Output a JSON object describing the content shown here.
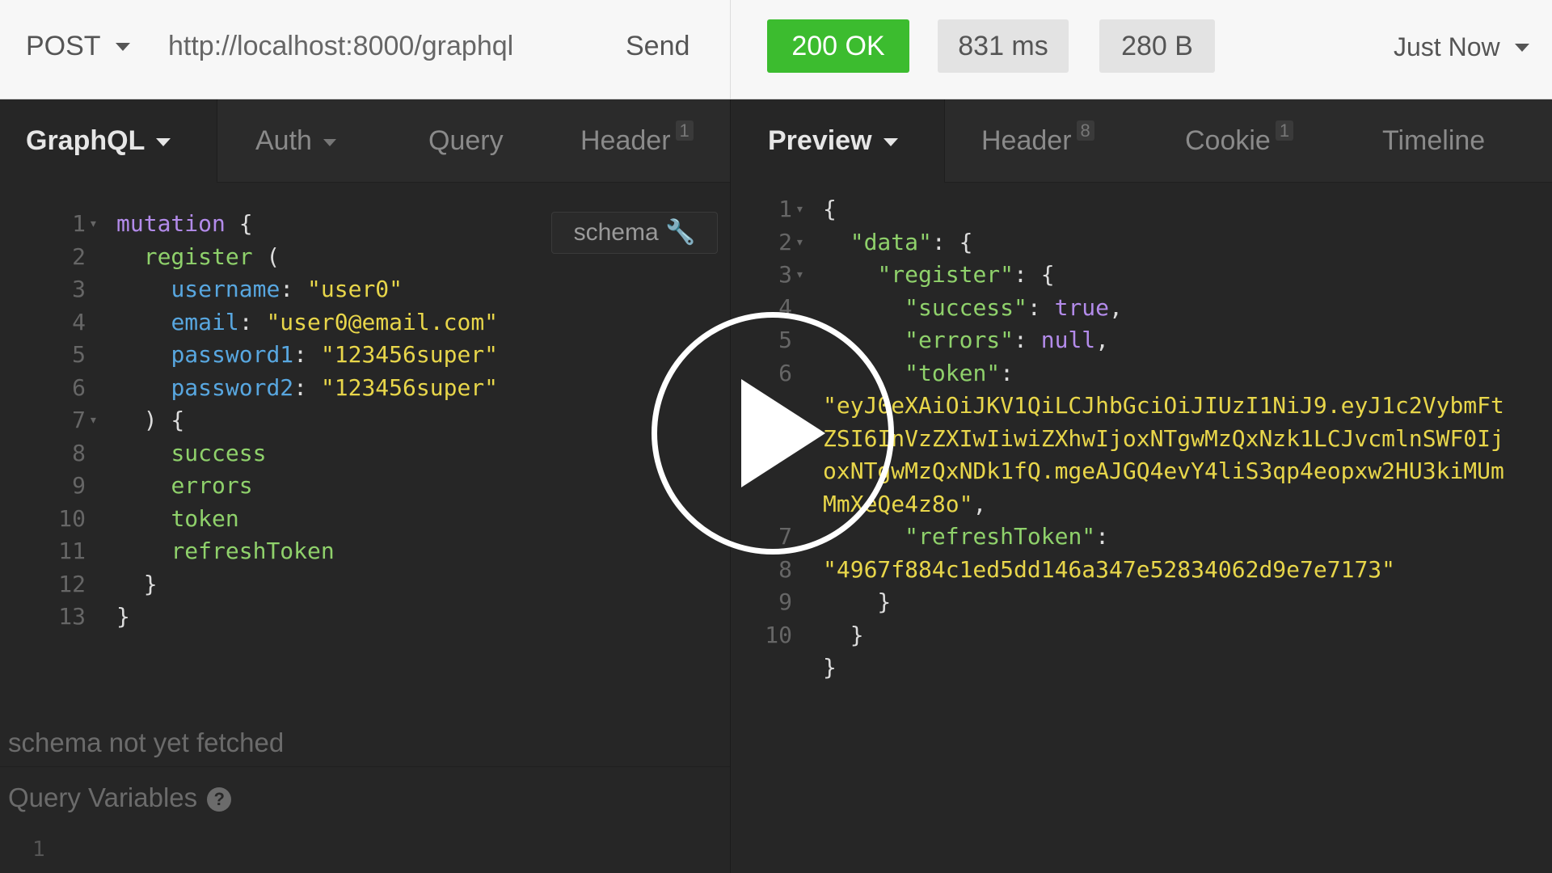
{
  "request": {
    "method": "POST",
    "url": "http://localhost:8000/graphql",
    "send_label": "Send"
  },
  "response": {
    "status": "200 OK",
    "time": "831 ms",
    "size": "280 B",
    "history": "Just Now"
  },
  "left_tabs": [
    {
      "label": "GraphQL"
    },
    {
      "label": "Auth"
    },
    {
      "label": "Query"
    },
    {
      "label": "Header",
      "count": "1"
    }
  ],
  "right_tabs": [
    {
      "label": "Preview"
    },
    {
      "label": "Header",
      "count": "8"
    },
    {
      "label": "Cookie",
      "count": "1"
    },
    {
      "label": "Timeline"
    }
  ],
  "editor": {
    "schema_button": "schema",
    "schema_message": "schema not yet fetched",
    "query_variables_label": "Query Variables",
    "query_variables_line": "1",
    "line_numbers": [
      "1",
      "2",
      "3",
      "4",
      "5",
      "6",
      "7",
      "8",
      "9",
      "10",
      "11",
      "12",
      "13"
    ],
    "mutation_kw": "mutation",
    "register_fn": "register",
    "args": [
      {
        "name": "username",
        "value": "\"user0\""
      },
      {
        "name": "email",
        "value": "\"user0@email.com\""
      },
      {
        "name": "password1",
        "value": "\"123456super\""
      },
      {
        "name": "password2",
        "value": "\"123456super\""
      }
    ],
    "fields": [
      "success",
      "errors",
      "token",
      "refreshToken"
    ]
  },
  "preview": {
    "line_numbers": [
      "1",
      "2",
      "3",
      "4",
      "5",
      "6",
      "7",
      "8",
      "9",
      "10"
    ],
    "key_data": "\"data\"",
    "key_register": "\"register\"",
    "key_success": "\"success\"",
    "val_success": "true",
    "key_errors": "\"errors\"",
    "val_errors": "null",
    "key_token": "\"token\"",
    "token_lines": [
      "\"eyJ0eXAiOiJKV1QiLCJhbGciOiJIUzI1NiJ9.eyJ1c2VybmFt",
      "ZSI6InVzZXIwIiwiZXhwIjoxNTgwMzQxNzk1LCJvcmlnSWF0Ij",
      "oxNTgwMzQxNDk1fQ.mgeAJGQ4evY4liS3qp4eopxw2HU3kiMUm",
      "MmXeQe4z8o\""
    ],
    "key_refresh": "\"refreshToken\"",
    "val_refresh": "\"4967f884c1ed5dd146a347e52834062d9e7e7173\""
  },
  "overlay": {
    "play_icon": "play-icon"
  }
}
